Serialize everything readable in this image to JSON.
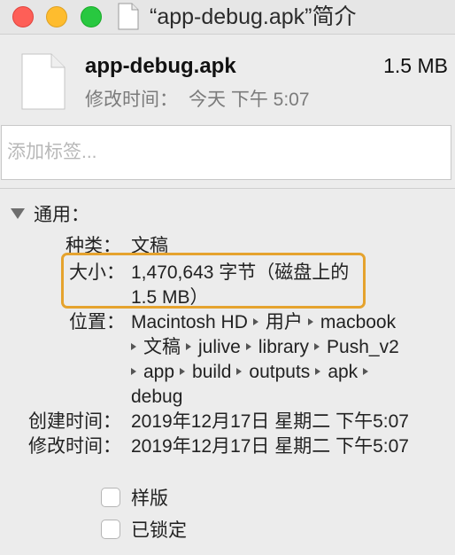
{
  "window": {
    "title": "“app-debug.apk”简介"
  },
  "header": {
    "file_name": "app-debug.apk",
    "file_size": "1.5 MB",
    "modified_label": "修改时间：",
    "modified_value": "今天 下午 5:07"
  },
  "tags": {
    "placeholder": "添加标签..."
  },
  "general": {
    "section_title": "通用：",
    "kind_label": "种类：",
    "kind_value": "文稿",
    "size_label": "大小：",
    "size_value_line1": "1,470,643 字节（磁盘上的",
    "size_value_line2": "1.5 MB）",
    "where_label": "位置：",
    "where_path": [
      "Macintosh HD",
      "用户",
      "macbook",
      "文稿",
      "julive",
      "library",
      "Push_v2",
      "app",
      "build",
      "outputs",
      "apk",
      "debug"
    ],
    "created_label": "创建时间：",
    "created_value": "2019年12月17日 星期二 下午5:07",
    "modified_label": "修改时间：",
    "modified_value": "2019年12月17日 星期二 下午5:07"
  },
  "options": {
    "stationery_label": "样版",
    "locked_label": "已锁定",
    "stationery_checked": false,
    "locked_checked": false
  },
  "colors": {
    "highlight": "#e5a32e",
    "close": "#fe5f57",
    "minimize": "#febc2e",
    "zoom": "#28c840"
  }
}
